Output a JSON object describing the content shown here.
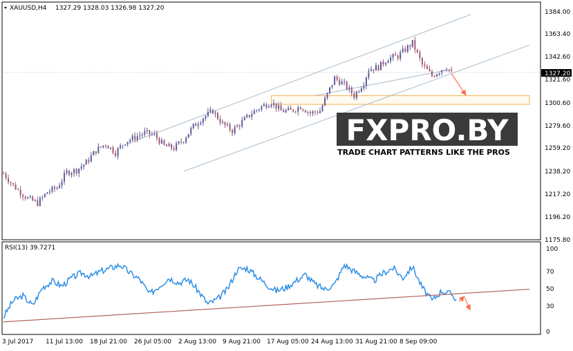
{
  "chart_data": [
    {
      "type": "candlestick",
      "symbol_label": "XAUUSD,H4",
      "ohlc_label": "1327.29 1328.03 1326.98 1327.20",
      "current_price_label": "1327.20",
      "ylim": [
        1175.8,
        1390
      ],
      "y_ticks": [
        "1384.00",
        "1363.40",
        "1342.60",
        "1321.60",
        "1300.60",
        "1279.60",
        "1259.20",
        "1238.20",
        "1217.20",
        "1196.20",
        "1175.80"
      ],
      "x_ticks": [
        "3 Jul 2017",
        "11 Jul 13:00",
        "18 Jul 21:00",
        "26 Jul 05:00",
        "2 Aug 13:00",
        "9 Aug 21:00",
        "17 Aug 05:00",
        "24 Aug 13:00",
        "31 Aug 21:00",
        "8 Sep 09:00"
      ],
      "price_path": [
        [
          0,
          1235
        ],
        [
          2,
          1224
        ],
        [
          5,
          1212
        ],
        [
          7,
          1208
        ],
        [
          9,
          1218
        ],
        [
          11,
          1222
        ],
        [
          13,
          1236
        ],
        [
          15,
          1238
        ],
        [
          17,
          1245
        ],
        [
          19,
          1256
        ],
        [
          21,
          1262
        ],
        [
          23,
          1254
        ],
        [
          25,
          1264
        ],
        [
          27,
          1268
        ],
        [
          29,
          1272
        ],
        [
          31,
          1270
        ],
        [
          33,
          1260
        ],
        [
          35,
          1258
        ],
        [
          37,
          1266
        ],
        [
          39,
          1278
        ],
        [
          41,
          1286
        ],
        [
          43,
          1292
        ],
        [
          45,
          1280
        ],
        [
          47,
          1274
        ],
        [
          49,
          1282
        ],
        [
          51,
          1290
        ],
        [
          53,
          1296
        ],
        [
          55,
          1300
        ],
        [
          57,
          1292
        ],
        [
          59,
          1292
        ],
        [
          61,
          1296
        ],
        [
          63,
          1290
        ],
        [
          65,
          1292
        ],
        [
          67,
          1312
        ],
        [
          68,
          1322
        ],
        [
          70,
          1316
        ],
        [
          72,
          1306
        ],
        [
          74,
          1318
        ],
        [
          75,
          1330
        ],
        [
          77,
          1332
        ],
        [
          79,
          1340
        ],
        [
          81,
          1342
        ],
        [
          83,
          1350
        ],
        [
          84,
          1354
        ],
        [
          86,
          1334
        ],
        [
          88,
          1324
        ],
        [
          90,
          1330
        ],
        [
          91,
          1332
        ],
        [
          92,
          1326
        ]
      ],
      "channel": {
        "upper": [
          [
            26,
            1263
          ],
          [
            96,
            1380
          ]
        ],
        "lower": [
          [
            37,
            1237
          ],
          [
            108,
            1352
          ]
        ],
        "middle": [
          [
            64,
            1306
          ],
          [
            92,
            1330
          ]
        ]
      },
      "support_zone": [
        1298,
        1306
      ],
      "support_zone_range": [
        55,
        108
      ],
      "arrow_forecast": [
        [
          92,
          1326
        ],
        [
          95,
          1306
        ]
      ]
    },
    {
      "type": "line",
      "indicator_label": "RSI(13) 39.7271",
      "ylim": [
        0,
        100
      ],
      "y_ticks": [
        "100",
        "70",
        "50",
        "30",
        "0"
      ],
      "series": [
        {
          "values": [
            [
              0,
              18
            ],
            [
              2,
              38
            ],
            [
              4,
              44
            ],
            [
              6,
              32
            ],
            [
              8,
              54
            ],
            [
              10,
              62
            ],
            [
              12,
              56
            ],
            [
              14,
              66
            ],
            [
              16,
              72
            ],
            [
              18,
              68
            ],
            [
              20,
              74
            ],
            [
              22,
              78
            ],
            [
              24,
              82
            ],
            [
              26,
              72
            ],
            [
              28,
              64
            ],
            [
              30,
              46
            ],
            [
              32,
              56
            ],
            [
              34,
              66
            ],
            [
              36,
              60
            ],
            [
              38,
              64
            ],
            [
              40,
              50
            ],
            [
              42,
              34
            ],
            [
              44,
              40
            ],
            [
              46,
              52
            ],
            [
              48,
              76
            ],
            [
              50,
              78
            ],
            [
              52,
              68
            ],
            [
              54,
              58
            ],
            [
              56,
              50
            ],
            [
              58,
              54
            ],
            [
              60,
              62
            ],
            [
              62,
              70
            ],
            [
              64,
              58
            ],
            [
              66,
              52
            ],
            [
              68,
              58
            ],
            [
              70,
              82
            ],
            [
              72,
              74
            ],
            [
              74,
              68
            ],
            [
              76,
              62
            ],
            [
              78,
              72
            ],
            [
              80,
              78
            ],
            [
              82,
              66
            ],
            [
              84,
              80
            ],
            [
              86,
              54
            ],
            [
              88,
              38
            ],
            [
              90,
              50
            ],
            [
              92,
              46
            ],
            [
              93,
              40
            ]
          ]
        }
      ],
      "trendline": [
        [
          0,
          12
        ],
        [
          108,
          52
        ]
      ],
      "arrow_forecast": [
        [
          93,
          42
        ],
        [
          95,
          26
        ]
      ]
    }
  ],
  "watermark": {
    "title": "FXPRO.BY",
    "tagline": "TRADE CHART PATTERNS LIKE THE PROS"
  },
  "colors": {
    "bull": "#5a5a9a",
    "bear": "#a05a74",
    "channel": "#a9bccb",
    "rsi": "#2f8ee6",
    "trendline": "#b06060",
    "arrow": "#ff6a50",
    "zone": "#f0b050",
    "logo_bg": "#3a3a3a",
    "logo_text": "#ffffff"
  }
}
